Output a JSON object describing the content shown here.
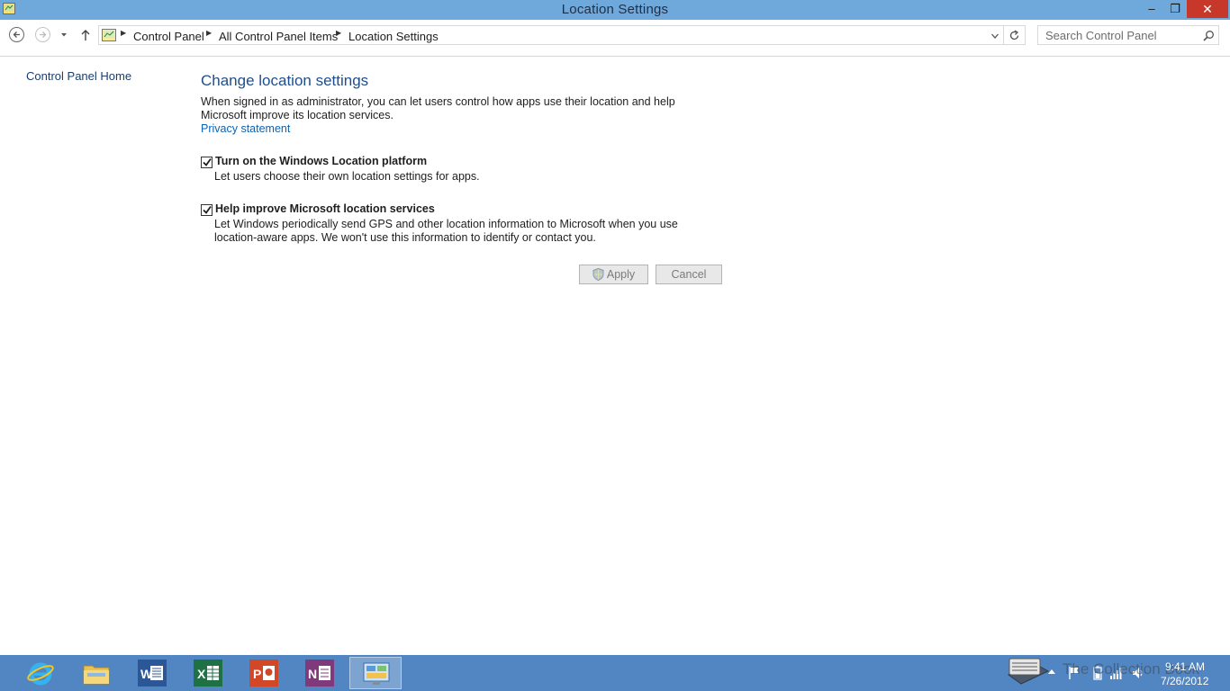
{
  "window": {
    "title": "Location Settings",
    "minimize_symbol": "–",
    "restore_symbol": "❐",
    "close_symbol": "✕"
  },
  "nav": {
    "breadcrumbs": [
      "Control Panel",
      "All Control Panel Items",
      "Location Settings"
    ],
    "search_placeholder": "Search Control Panel"
  },
  "sidebar": {
    "home_link": "Control Panel Home"
  },
  "main": {
    "heading": "Change location settings",
    "description": "When signed in as administrator, you can let users control how apps use their location and help Microsoft improve its location services.",
    "privacy_link": "Privacy statement",
    "options": [
      {
        "label": "Turn on the Windows Location platform",
        "description": "Let users choose their own location settings for apps.",
        "checked": true
      },
      {
        "label": "Help improve Microsoft location services",
        "description": "Let Windows periodically send GPS and other location information to Microsoft when you use location-aware apps. We won't use this information to identify or contact you.",
        "checked": true
      }
    ],
    "apply_label": "Apply",
    "cancel_label": "Cancel"
  },
  "taskbar": {
    "apps": [
      {
        "name": "internet-explorer",
        "icon": "ie-icon"
      },
      {
        "name": "file-explorer",
        "icon": "folder-icon"
      },
      {
        "name": "word",
        "icon": "word-icon"
      },
      {
        "name": "excel",
        "icon": "excel-icon"
      },
      {
        "name": "powerpoint",
        "icon": "powerpoint-icon"
      },
      {
        "name": "onenote",
        "icon": "onenote-icon"
      },
      {
        "name": "control-panel",
        "icon": "control-panel-icon",
        "active": true
      }
    ],
    "clock_time": "9:41 AM",
    "clock_date": "7/26/2012",
    "watermark": "The Collection Book"
  },
  "colors": {
    "titlebar": "#6fa9dc",
    "taskbar": "#5286c2",
    "heading": "#1f4e8c",
    "link": "#0b63b2",
    "close": "#c7382b"
  }
}
